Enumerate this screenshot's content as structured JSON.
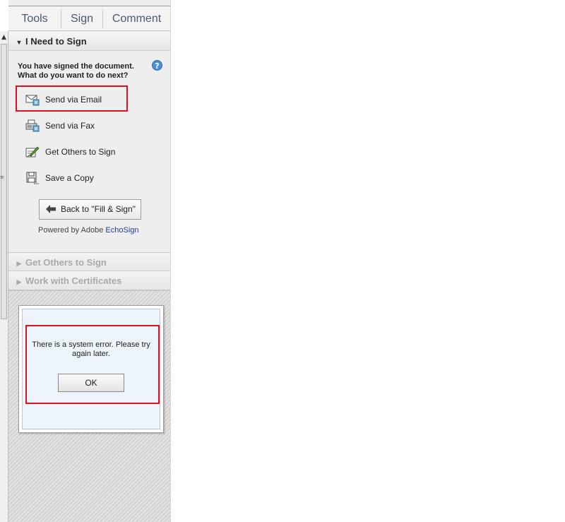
{
  "tabs": [
    {
      "label": "Tools"
    },
    {
      "label": "Sign"
    },
    {
      "label": "Comment"
    }
  ],
  "sections": {
    "sign": {
      "title": "I Need to Sign",
      "expanded": true
    },
    "get_others": {
      "title": "Get Others to Sign",
      "expanded": false
    },
    "certificates": {
      "title": "Work with Certificates",
      "expanded": false
    }
  },
  "sign_panel": {
    "intro_line1": "You have signed the document.",
    "intro_line2": "What do you want to do next?",
    "help_icon": "?",
    "actions": [
      {
        "label": "Send via Email",
        "icon": "email-icon"
      },
      {
        "label": "Send via Fax",
        "icon": "fax-icon"
      },
      {
        "label": "Get Others to Sign",
        "icon": "get-others-icon"
      },
      {
        "label": "Save a Copy",
        "icon": "save-icon"
      }
    ],
    "back_button_label": "Back to \"Fill & Sign\"",
    "powered_by": "Powered by Adobe ",
    "echosign_link": "EchoSign"
  },
  "dialog": {
    "message": "There is a system error. Please try again later.",
    "ok_label": "OK"
  },
  "colors": {
    "highlight": "#e01020",
    "tab_text": "#4a5a73",
    "link": "#1f3aa6",
    "dialog_bg": "#eef4fb"
  }
}
